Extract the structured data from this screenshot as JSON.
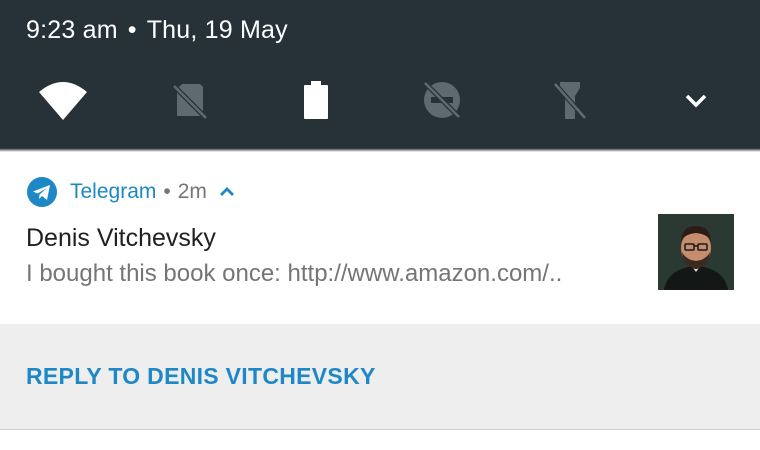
{
  "status_bar": {
    "time": "9:23 am",
    "separator": "•",
    "date": "Thu, 19 May"
  },
  "quick_settings": {
    "tiles": [
      {
        "icon": "wifi-icon",
        "state": "on"
      },
      {
        "icon": "sim-off-icon",
        "state": "off"
      },
      {
        "icon": "battery-icon",
        "state": "full"
      },
      {
        "icon": "do-not-disturb-off-icon",
        "state": "off"
      },
      {
        "icon": "flashlight-off-icon",
        "state": "off"
      }
    ],
    "expand_icon": "chevron-down-icon"
  },
  "notification": {
    "app_name": "Telegram",
    "separator": "•",
    "time": "2m",
    "sender": "Denis Vitchevsky",
    "message": "I bought this book once: http://www.amazon.com/..",
    "accent_color": "#1e88c7"
  },
  "actions": {
    "reply_label": "REPLY TO DENIS VITCHEVSKY"
  }
}
